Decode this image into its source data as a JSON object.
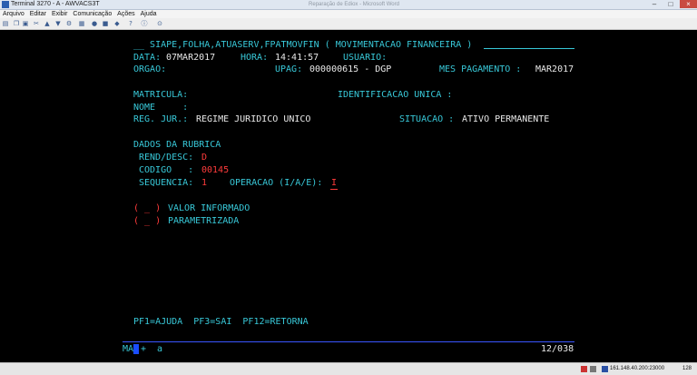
{
  "window": {
    "title": "Terminal 3270 - A - AWVACS3T",
    "center_title": "Reparação de Ediox - Microsoft Word",
    "buttons": {
      "minimize": "–",
      "maximize": "□",
      "close": "×"
    }
  },
  "menu": [
    "Arquivo",
    "Editar",
    "Exibir",
    "Comunicação",
    "Ações",
    "Ajuda"
  ],
  "toolbar_icons": [
    "print-icon",
    "copy-icon",
    "paste-icon",
    "cut-icon",
    "send-icon",
    "receive-icon",
    "settings-icon",
    "map-icon",
    "record-icon",
    "stop-icon",
    "color-icon",
    "help-icon"
  ],
  "screen": {
    "header": "__ SIAPE,FOLHA,ATUASERV,FPATMOVFIN ( MOVIMENTACAO FINANCEIRA )",
    "data_label": "DATA:",
    "data_value": "07MAR2017",
    "hora_label": "HORA:",
    "hora_value": "14:41:57",
    "usuario_label": "USUARIO:",
    "orgao_label": "ORGAO:",
    "upag_label": "UPAG:",
    "upag_value": "000000615 - DGP",
    "mes_label": "MES PAGAMENTO :",
    "mes_value": "MAR2017",
    "matricula_label": "MATRICULA:",
    "ident_label": "IDENTIFICACAO UNICA :",
    "nome_label": "NOME     :",
    "reg_label": "REG. JUR.:",
    "reg_value": "REGIME JURIDICO UNICO",
    "situacao_label": "SITUACAO :",
    "situacao_value": "ATIVO PERMANENTE",
    "dados_label": "DADOS DA RUBRICA",
    "rend_label": "REND/DESC:",
    "rend_value": "D",
    "codigo_label": "CODIGO   :",
    "codigo_value": "00145",
    "sequencia_label": "SEQUENCIA:",
    "sequencia_value": "1",
    "operacao_label": "OPERACAO (I/A/E):",
    "operacao_value": "I",
    "opt1_box": "( _ )",
    "opt1_label": "VALOR INFORMADO",
    "opt2_box": "( _ )",
    "opt2_label": "PARAMETRIZADA",
    "pf_keys": "PF1=AJUDA  PF3=SAI  PF12=RETORNA",
    "status_left": "MA",
    "status_plus": "+",
    "status_a": "a",
    "status_pos": "12/038"
  },
  "statusbar": {
    "ip": "161.148.40.200:23000",
    "number": "128"
  },
  "colors": {
    "field": "#38c8d8",
    "value": "#e8e8e8",
    "input": "#ff3b3b",
    "cursor": "#1a4dff"
  }
}
